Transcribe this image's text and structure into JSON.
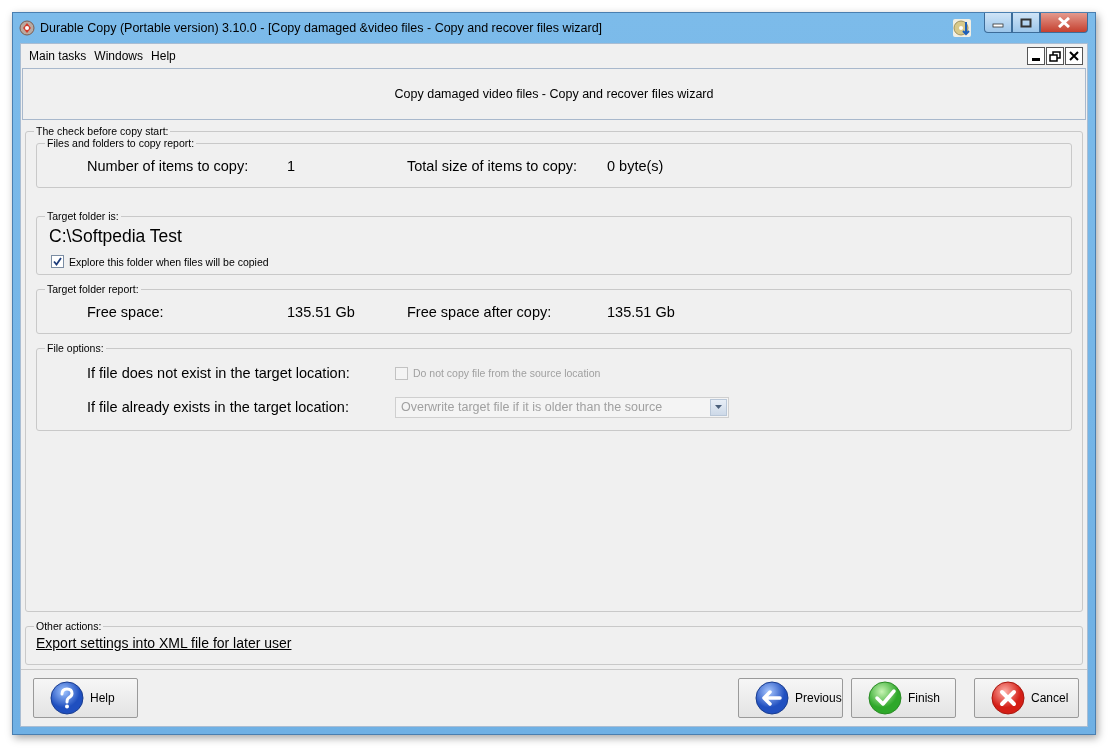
{
  "window": {
    "title": "Durable Copy (Portable version) 3.10.0 - [Copy damaged &video files - Copy and recover files wizard]"
  },
  "menu": [
    "Main tasks",
    "Windows",
    "Help"
  ],
  "header": "Copy damaged video files - Copy and recover files wizard",
  "check_group": {
    "title": "The check before copy start:",
    "copy_report": {
      "title": "Files and folders to copy report:",
      "items": [
        {
          "label": "Number of items to copy:",
          "value": "1"
        },
        {
          "label": "Total size of items to copy:",
          "value": "0 byte(s)"
        }
      ]
    },
    "target": {
      "title": "Target folder is:",
      "path": "C:\\Softpedia Test",
      "explore_checkbox": {
        "label": "Explore this folder when files will be copied",
        "checked": true
      }
    },
    "target_report": {
      "title": "Target folder report:",
      "items": [
        {
          "label": "Free space:",
          "value": "135.51 Gb"
        },
        {
          "label": "Free space after copy:",
          "value": "135.51 Gb"
        }
      ]
    },
    "file_options": {
      "title": "File options:",
      "rows": [
        {
          "kind": "checkbox",
          "label": "If file does not exist in the target location:",
          "option": "Do not copy file from the source location",
          "checked": false,
          "disabled": true
        },
        {
          "kind": "dropdown",
          "label": "If file already exists in the target location:",
          "value": "Overwrite target file if it is older than the source",
          "disabled": true
        }
      ]
    }
  },
  "other_actions": {
    "title": "Other actions:",
    "link": "Export settings into XML file for later user"
  },
  "buttons": [
    {
      "kind": "help",
      "label": "Help"
    },
    {
      "kind": "previous",
      "label": "Previous"
    },
    {
      "kind": "finish",
      "label": "Finish"
    },
    {
      "kind": "cancel",
      "label": "Cancel"
    }
  ]
}
